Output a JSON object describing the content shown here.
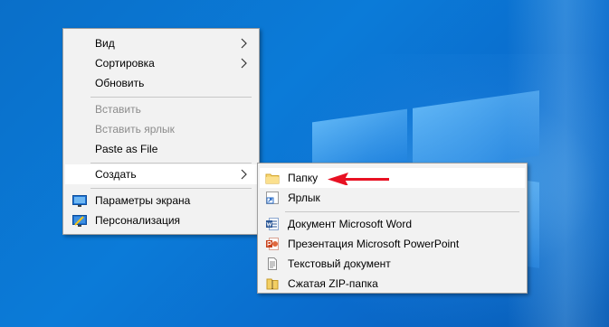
{
  "main_menu": {
    "items": [
      {
        "label": "Вид",
        "has_submenu": true,
        "enabled": true
      },
      {
        "label": "Сортировка",
        "has_submenu": true,
        "enabled": true
      },
      {
        "label": "Обновить",
        "enabled": true
      },
      {
        "label": "Вставить",
        "enabled": false
      },
      {
        "label": "Вставить ярлык",
        "enabled": false
      },
      {
        "label": "Paste as File",
        "enabled": true
      },
      {
        "label": "Создать",
        "has_submenu": true,
        "enabled": true,
        "highlighted": true
      },
      {
        "label": "Параметры экрана",
        "icon": "display-settings-icon",
        "enabled": true
      },
      {
        "label": "Персонализация",
        "icon": "personalization-icon",
        "enabled": true
      }
    ]
  },
  "create_submenu": {
    "items": [
      {
        "label": "Папку",
        "icon": "folder-icon",
        "highlighted": true
      },
      {
        "label": "Ярлык",
        "icon": "shortcut-icon"
      },
      {
        "label": "Документ Microsoft Word",
        "icon": "word-document-icon"
      },
      {
        "label": "Презентация Microsoft PowerPoint",
        "icon": "powerpoint-presentation-icon"
      },
      {
        "label": "Текстовый документ",
        "icon": "text-document-icon"
      },
      {
        "label": "Сжатая ZIP-папка",
        "icon": "zip-folder-icon"
      }
    ]
  },
  "annotation": {
    "arrow_color": "#e81123",
    "points_to": "Папку"
  },
  "colors": {
    "menu_bg": "#f2f2f2",
    "highlight": "#ffffff",
    "disabled_text": "#8c8c8c",
    "desktop": "#0b74d4"
  }
}
